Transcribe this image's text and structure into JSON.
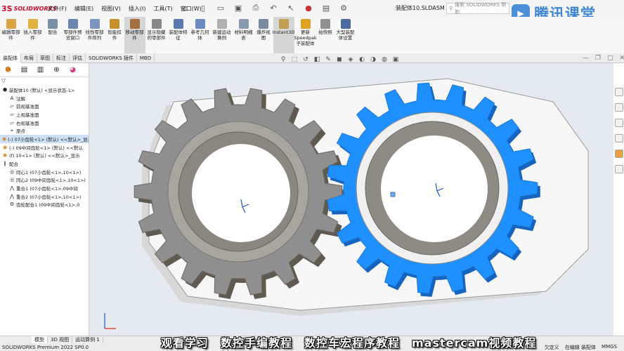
{
  "app": {
    "brand_prefix": "3S",
    "brand": "SOLIDWORKS",
    "menus": [
      "文件(F)",
      "编辑(E)",
      "视图(V)",
      "插入(I)",
      "工具(T)",
      "窗口(W)"
    ],
    "document_title": "装配体10.SLDASM *",
    "help_search_placeholder": "搜索 SOLIDWORKS 帮助",
    "watermark_text": "腾讯课堂"
  },
  "ribbon": {
    "buttons": [
      {
        "label": "编辑零部件",
        "icon": "edit-component-icon",
        "color": "#d9a441"
      },
      {
        "label": "插入零部件",
        "icon": "insert-component-icon",
        "color": "#e0b040"
      },
      {
        "label": "配合",
        "icon": "mate-icon",
        "color": "#7c8fa8"
      },
      {
        "label": "零部件预览窗口",
        "icon": "component-preview-icon",
        "color": "#6a86b0"
      },
      {
        "label": "线性零部件阵列",
        "icon": "linear-pattern-icon",
        "color": "#7a96c0"
      },
      {
        "label": "智能扣件",
        "icon": "smart-fastener-icon",
        "color": "#c8902a"
      },
      {
        "label": "移动零部件",
        "icon": "move-component-icon",
        "color": "#a07040",
        "active": true
      },
      {
        "label": "显示隐藏的零部件",
        "icon": "show-hidden-icon",
        "color": "#888888"
      },
      {
        "label": "装配体特征",
        "icon": "assembly-feature-icon",
        "color": "#5a7ab0"
      },
      {
        "label": "参考几何体",
        "icon": "reference-geometry-icon",
        "color": "#6a8ac0"
      },
      {
        "label": "新建运动算例",
        "icon": "motion-study-icon",
        "color": "#b0b0b0"
      },
      {
        "label": "材料明细表",
        "icon": "bom-icon",
        "color": "#8a9ab0"
      },
      {
        "label": "爆炸视图",
        "icon": "exploded-view-icon",
        "color": "#7a8aa0"
      },
      {
        "label": "Instant3D",
        "icon": "instant3d-icon",
        "color": "#c0a050",
        "active": true
      },
      {
        "label": "更新Speedpak子装配体",
        "icon": "speedpak-icon",
        "color": "#e0a020"
      },
      {
        "label": "拍快照",
        "icon": "snapshot-icon",
        "color": "#909090"
      },
      {
        "label": "大型装配体设置",
        "icon": "large-assembly-icon",
        "color": "#4a6aa0"
      }
    ]
  },
  "command_tabs": [
    "装配体",
    "布局",
    "草图",
    "标注",
    "评估",
    "SOLIDWORKS 插件",
    "MBD"
  ],
  "feature_tree": {
    "items": [
      {
        "label": "装配体10 (默认) <显示状态-1>",
        "indent": 0,
        "icon": "assembly-icon",
        "sel": false
      },
      {
        "label": "注解",
        "indent": 1,
        "icon": "annotations-icon",
        "sel": false
      },
      {
        "label": "前视基准面",
        "indent": 1,
        "icon": "plane-icon",
        "sel": false
      },
      {
        "label": "上视基准面",
        "indent": 1,
        "icon": "plane-icon",
        "sel": false
      },
      {
        "label": "右视基准面",
        "indent": 1,
        "icon": "plane-icon",
        "sel": false
      },
      {
        "label": "原点",
        "indent": 1,
        "icon": "origin-icon",
        "sel": false
      },
      {
        "label": "(-) 07小齿轮<1> (默认) <<默认>_显示",
        "indent": 0,
        "icon": "part-icon",
        "sel": true
      },
      {
        "label": "(-) 09中间齿轮<1> (默认) <<默认",
        "indent": 0,
        "icon": "part-icon",
        "sel": false
      },
      {
        "label": "(f) 10<1> (默认) <<默认>_显示",
        "indent": 0,
        "icon": "part-icon",
        "sel": false
      },
      {
        "label": "配合",
        "indent": 0,
        "icon": "mates-icon",
        "sel": false
      },
      {
        "label": "同心1 (07小齿轮<1>,10<1>)",
        "indent": 1,
        "icon": "concentric-icon",
        "sel": false
      },
      {
        "label": "同心2 (09中间齿轮<1>,10<1>)",
        "indent": 1,
        "icon": "concentric-icon",
        "sel": false
      },
      {
        "label": "重合1 (07小齿轮<1>,09中间",
        "indent": 1,
        "icon": "coincident-icon",
        "sel": false
      },
      {
        "label": "重合2 (07小齿轮<1>,10<1>)",
        "indent": 1,
        "icon": "coincident-icon",
        "sel": false
      },
      {
        "label": "齿轮配合1 (09中间齿轮<1>,0",
        "indent": 1,
        "icon": "gear-mate-icon",
        "sel": false
      }
    ]
  },
  "view_tools": [
    "search-view-icon",
    "zoom-area-icon",
    "previous-view-icon",
    "section-view-icon",
    "dynamic-annotation-icon",
    "display-style-icon",
    "view-orientation-icon",
    "hide-show-icon",
    "edit-appearance-icon",
    "scene-icon",
    "view-settings-icon"
  ],
  "viewport_controls": [
    "minimize",
    "restore",
    "maximize",
    "close"
  ],
  "model_tabs": [
    "模型",
    "3D 视图",
    "运动算例 1"
  ],
  "status": {
    "left": "SOLIDWORKS Premium 2022 SP0.0",
    "right": [
      "欠定义",
      "在编辑 装配体",
      "MMGS"
    ]
  },
  "subtitle": "观看学习　数控手编教程　数控车宏程序教程　mastercam视频教程",
  "colors": {
    "gear_gray": "#8f8f8f",
    "gear_blue": "#1e90ff",
    "housing": "#f7f7f7",
    "background": "#e5eaf1"
  }
}
